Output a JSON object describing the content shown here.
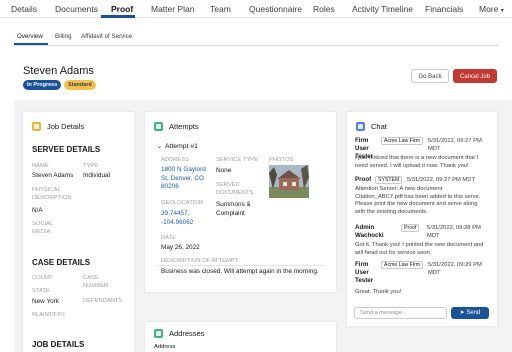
{
  "nav": {
    "tabs": [
      "Details",
      "Documents",
      "Proof",
      "Matter Plan",
      "Team",
      "Questionnaire",
      "Roles",
      "Activity Timeline",
      "Financials"
    ],
    "more": "More",
    "active": "Proof"
  },
  "subnav": {
    "tabs": [
      "Overview",
      "Billing",
      "Affidavit of Service"
    ],
    "active": "Overview"
  },
  "header": {
    "name": "Steven Adams",
    "badges": [
      "In Progress",
      "Standard"
    ],
    "go_back": "Go Back",
    "cancel_job": "Cancel Job"
  },
  "job": {
    "title": "Job Details",
    "servee_heading": "SERVEE DETAILS",
    "name_label": "NAME",
    "name_value": "Steven Adams",
    "type_label": "TYPE",
    "type_value": "Individual",
    "physical_label": "PHYSICAL DESCRIPTION",
    "physical_value": "N/A",
    "social_label": "SOCIAL MEDIA",
    "case_heading": "CASE DETAILS",
    "count_label": "COUNT",
    "case_number_label": "CASE NUMBER",
    "state_label": "STATE",
    "state_value": "New York",
    "defendants_label": "DEFENDANTS",
    "plaintiffs_label": "PLAINTIFFS",
    "job_heading": "JOB DETAILS"
  },
  "attempts": {
    "title": "Attempts",
    "attempt_label": "Attempt #1",
    "address_label": "ADDRESS",
    "address_value": "1800 N Gaylord St, Denver, CO 80206",
    "service_type_label": "SERVICE TYPE",
    "service_type_value": "None",
    "photos_label": "PHOTOS",
    "geolocation_label": "GEOLOCATION",
    "geolocation_value": "39.74457, -104.96062",
    "served_docs_label": "SERVED DOCUMENTS",
    "served_docs_value": "Summons & Complaint",
    "date_label": "DATE",
    "date_value": "May 26, 2022",
    "description_label": "DESCRIPTION OF ATTEMPT",
    "description_value": "Business was closed. Will attempt again in the morning."
  },
  "addresses": {
    "title": "Addresses",
    "field_label": "Address"
  },
  "chat": {
    "title": "Chat",
    "messages": [
      {
        "sender": "Firm User Tester",
        "tag": "Acme Law Firm",
        "time": "5/31/2022, 09:27 PM MDT",
        "text": "I just noticed that there is a new document that I need served. I will upload it now. Thank you!"
      },
      {
        "sender": "Proof",
        "tag": "SYSTEM",
        "time": "5/31/2022, 09:27 PM MDT",
        "text": "Attention Server: A new document Citation_ABC7.pdf has been added to this serve. Please print the new document and serve along with the existing documents."
      },
      {
        "sender": "Admin Wachocki",
        "tag": "Proof",
        "time": "5/31/2022, 09:28 PM MDT",
        "text": "Got it. Thank you! I printed the new document and will head out for service soon."
      },
      {
        "sender": "Firm User Tester",
        "tag": "Acme Law Firm",
        "time": "5/31/2022, 09:29 PM MDT",
        "text": "Great. Thank you!"
      }
    ],
    "input_placeholder": "Send a message...",
    "send_label": "Send"
  },
  "colors": {
    "brand": "#1b5297",
    "cancel": "#c23934",
    "in_progress": "#1b5297",
    "standard": "#f2c24d",
    "job_icon": "#e9b437",
    "attempts_icon": "#3fb27f",
    "address_icon": "#3fb27f",
    "chat_icon": "#5a7fd6"
  }
}
